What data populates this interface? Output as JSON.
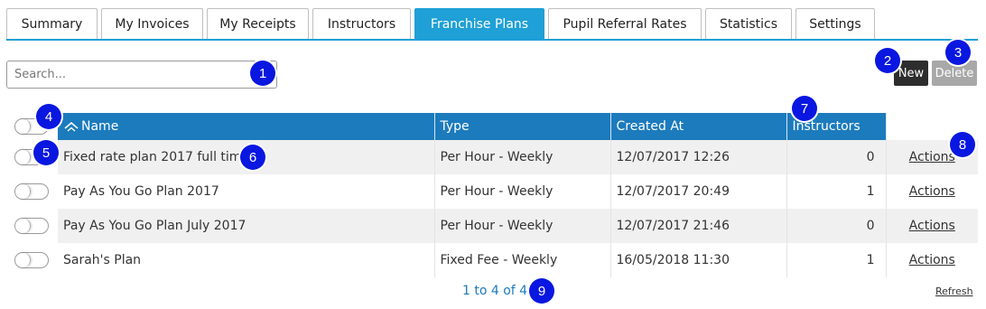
{
  "tabs": [
    {
      "label": "Summary"
    },
    {
      "label": "My Invoices"
    },
    {
      "label": "My Receipts"
    },
    {
      "label": "Instructors"
    },
    {
      "label": "Franchise Plans",
      "active": true
    },
    {
      "label": "Pupil Referral Rates"
    },
    {
      "label": "Statistics"
    },
    {
      "label": "Settings"
    }
  ],
  "search": {
    "placeholder": "Search...",
    "value": ""
  },
  "toolbar": {
    "new_label": "New",
    "delete_label": "Delete"
  },
  "table": {
    "columns": [
      "Name",
      "Type",
      "Created At",
      "Instructors"
    ],
    "rows": [
      {
        "name": "Fixed rate plan 2017 full time",
        "type": "Per Hour - Weekly",
        "created": "12/07/2017 12:26",
        "instructors": "0",
        "action": "Actions"
      },
      {
        "name": "Pay As You Go Plan 2017",
        "type": "Per Hour - Weekly",
        "created": "12/07/2017 20:49",
        "instructors": "1",
        "action": "Actions"
      },
      {
        "name": "Pay As You Go Plan July 2017",
        "type": "Per Hour - Weekly",
        "created": "12/07/2017 21:46",
        "instructors": "0",
        "action": "Actions"
      },
      {
        "name": "Sarah's Plan",
        "type": "Fixed Fee - Weekly",
        "created": "16/05/2018 11:30",
        "instructors": "1",
        "action": "Actions"
      }
    ]
  },
  "footer": {
    "pager": "1 to 4 of 4",
    "refresh": "Refresh"
  },
  "markers": [
    "1",
    "2",
    "3",
    "4",
    "5",
    "6",
    "7",
    "8",
    "9"
  ],
  "colors": {
    "accent": "#1fa0d6",
    "header": "#1c7bbd",
    "marker": "#0a17e0"
  }
}
